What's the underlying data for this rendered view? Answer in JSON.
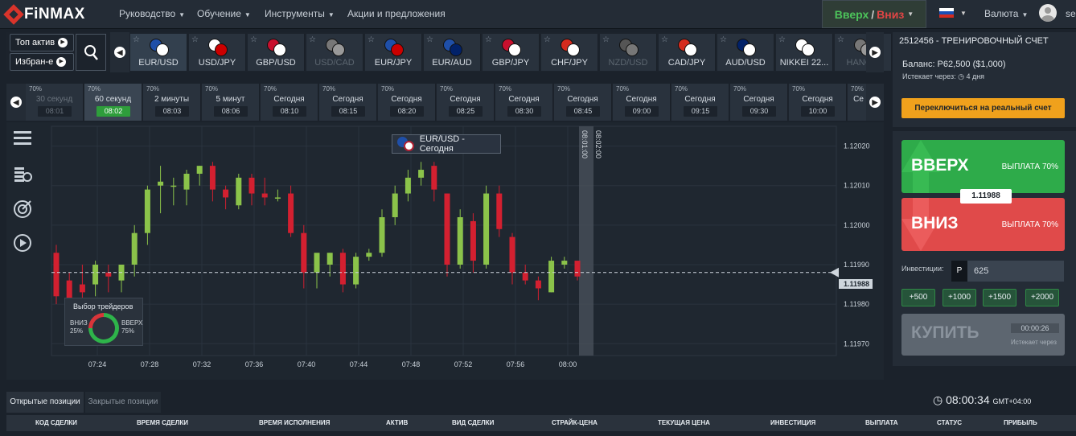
{
  "app": {
    "brand": "FiNMAX"
  },
  "nav": {
    "items": [
      "Руководство",
      "Обучение",
      "Инструменты",
      "Акции и предложения"
    ],
    "updown_up": "Вверх",
    "updown_sep": "/",
    "updown_down": "Вниз",
    "currency_label": "Валюта",
    "user_partial": "se"
  },
  "assets": {
    "top_button": "Топ актив",
    "fav_button": "Избран-е",
    "tabs": [
      {
        "label": "EUR/USD",
        "state": "active",
        "c1": "#1f4fa8",
        "c2": "#ffffff"
      },
      {
        "label": "USD/JPY",
        "state": "normal",
        "c1": "#ffffff",
        "c2": "#cc0000"
      },
      {
        "label": "GBP/USD",
        "state": "normal",
        "c1": "#c8102e",
        "c2": "#ffffff"
      },
      {
        "label": "USD/CAD",
        "state": "disabled",
        "c1": "#777777",
        "c2": "#999999"
      },
      {
        "label": "EUR/JPY",
        "state": "normal",
        "c1": "#1f4fa8",
        "c2": "#cc0000"
      },
      {
        "label": "EUR/AUD",
        "state": "normal",
        "c1": "#1f4fa8",
        "c2": "#012169"
      },
      {
        "label": "GBP/JPY",
        "state": "normal",
        "c1": "#c8102e",
        "c2": "#ffffff"
      },
      {
        "label": "CHF/JPY",
        "state": "normal",
        "c1": "#d52b1e",
        "c2": "#ffffff"
      },
      {
        "label": "NZD/USD",
        "state": "disabled",
        "c1": "#555555",
        "c2": "#777777"
      },
      {
        "label": "CAD/JPY",
        "state": "normal",
        "c1": "#d52b1e",
        "c2": "#ffffff"
      },
      {
        "label": "AUD/USD",
        "state": "normal",
        "c1": "#012169",
        "c2": "#ffffff"
      },
      {
        "label": "NIKKEI 22...",
        "state": "normal",
        "c1": "#ffffff",
        "c2": "#ffffff"
      },
      {
        "label": "HANG...",
        "state": "disabled",
        "c1": "#777777",
        "c2": "#999999"
      }
    ]
  },
  "times": {
    "tabs": [
      {
        "pct": "70%",
        "label": "30 секунд",
        "time": "08:01",
        "state": "disabled"
      },
      {
        "pct": "70%",
        "label": "60 секунд",
        "time": "08:02",
        "state": "active"
      },
      {
        "pct": "70%",
        "label": "2 минуты",
        "time": "08:03",
        "state": "normal"
      },
      {
        "pct": "70%",
        "label": "5 минут",
        "time": "08:06",
        "state": "normal"
      },
      {
        "pct": "70%",
        "label": "Сегодня",
        "time": "08:10",
        "state": "normal"
      },
      {
        "pct": "70%",
        "label": "Сегодня",
        "time": "08:15",
        "state": "normal"
      },
      {
        "pct": "70%",
        "label": "Сегодня",
        "time": "08:20",
        "state": "normal"
      },
      {
        "pct": "70%",
        "label": "Сегодня",
        "time": "08:25",
        "state": "normal"
      },
      {
        "pct": "70%",
        "label": "Сегодня",
        "time": "08:30",
        "state": "normal"
      },
      {
        "pct": "70%",
        "label": "Сегодня",
        "time": "08:45",
        "state": "normal"
      },
      {
        "pct": "70%",
        "label": "Сегодня",
        "time": "09:00",
        "state": "normal"
      },
      {
        "pct": "70%",
        "label": "Сегодня",
        "time": "09:15",
        "state": "normal"
      },
      {
        "pct": "70%",
        "label": "Сегодня",
        "time": "09:30",
        "state": "normal"
      },
      {
        "pct": "70%",
        "label": "Сегодня",
        "time": "10:00",
        "state": "normal"
      },
      {
        "pct": "70%",
        "label": "Се",
        "time": "",
        "state": "normal"
      }
    ]
  },
  "chart": {
    "tools": [
      "⊕",
      "⊖",
      "ıl",
      "1h",
      "⤴"
    ],
    "asset_label": "EUR/USD - Сегодня",
    "expiry_label_1": "08:01:00",
    "expiry_label_2": "08:02:00",
    "current_price": "1.11988",
    "traders_title": "Выбор трейдеров",
    "traders_down_label": "ВНИЗ",
    "traders_down_pct": "25%",
    "traders_up_label": "ВВЕРХ",
    "traders_up_pct": "75%"
  },
  "chart_data": {
    "type": "candlestick",
    "x_ticks": [
      "07:24",
      "07:28",
      "07:32",
      "07:36",
      "07:40",
      "07:44",
      "07:48",
      "07:52",
      "07:56",
      "08:00"
    ],
    "y_ticks": [
      "1.12020",
      "1.12010",
      "1.12000",
      "1.11990",
      "1.11980",
      "1.11970"
    ],
    "ylim": [
      1.11967,
      1.12025
    ],
    "xlim_minutes": [
      1.7,
      40
    ],
    "current_price": 1.11988,
    "candles": [
      {
        "t": 2,
        "o": 1.11993,
        "h": 1.11995,
        "l": 1.1198,
        "c": 1.11982
      },
      {
        "t": 3,
        "o": 1.11986,
        "h": 1.11988,
        "l": 1.11978,
        "c": 1.1198
      },
      {
        "t": 4,
        "o": 1.11985,
        "h": 1.1199,
        "l": 1.11978,
        "c": 1.11983
      },
      {
        "t": 5,
        "o": 1.11985,
        "h": 1.11991,
        "l": 1.11982,
        "c": 1.1199
      },
      {
        "t": 6,
        "o": 1.11988,
        "h": 1.1199,
        "l": 1.11983,
        "c": 1.11987
      },
      {
        "t": 7,
        "o": 1.11986,
        "h": 1.1199,
        "l": 1.11983,
        "c": 1.1199
      },
      {
        "t": 8,
        "o": 1.1199,
        "h": 1.12,
        "l": 1.11987,
        "c": 1.11998
      },
      {
        "t": 9,
        "o": 1.11998,
        "h": 1.1201,
        "l": 1.11995,
        "c": 1.12009
      },
      {
        "t": 10,
        "o": 1.1201,
        "h": 1.12015,
        "l": 1.12003,
        "c": 1.12011
      },
      {
        "t": 11,
        "o": 1.1201,
        "h": 1.12012,
        "l": 1.12005,
        "c": 1.1201
      },
      {
        "t": 12,
        "o": 1.12009,
        "h": 1.12014,
        "l": 1.12005,
        "c": 1.12013
      },
      {
        "t": 13,
        "o": 1.12013,
        "h": 1.12015,
        "l": 1.1201,
        "c": 1.12015
      },
      {
        "t": 14,
        "o": 1.12015,
        "h": 1.12016,
        "l": 1.12006,
        "c": 1.12009
      },
      {
        "t": 15,
        "o": 1.12009,
        "h": 1.1201,
        "l": 1.12004,
        "c": 1.12007
      },
      {
        "t": 16,
        "o": 1.12005,
        "h": 1.12013,
        "l": 1.12004,
        "c": 1.12012
      },
      {
        "t": 17,
        "o": 1.12012,
        "h": 1.12013,
        "l": 1.12005,
        "c": 1.12008
      },
      {
        "t": 18,
        "o": 1.12008,
        "h": 1.12012,
        "l": 1.12005,
        "c": 1.12007
      },
      {
        "t": 19,
        "o": 1.12007,
        "h": 1.12009,
        "l": 1.12006,
        "c": 1.12007
      },
      {
        "t": 20,
        "o": 1.12008,
        "h": 1.1201,
        "l": 1.11997,
        "c": 1.11998
      },
      {
        "t": 21,
        "o": 1.11998,
        "h": 1.12,
        "l": 1.11984,
        "c": 1.11988
      },
      {
        "t": 22,
        "o": 1.11988,
        "h": 1.11991,
        "l": 1.11984,
        "c": 1.11993
      },
      {
        "t": 23,
        "o": 1.1199,
        "h": 1.11993,
        "l": 1.11987,
        "c": 1.11993
      },
      {
        "t": 24,
        "o": 1.11993,
        "h": 1.11994,
        "l": 1.11983,
        "c": 1.11985
      },
      {
        "t": 25,
        "o": 1.11985,
        "h": 1.11993,
        "l": 1.11984,
        "c": 1.11992
      },
      {
        "t": 26,
        "o": 1.11992,
        "h": 1.11994,
        "l": 1.11991,
        "c": 1.11993
      },
      {
        "t": 27,
        "o": 1.11993,
        "h": 1.12004,
        "l": 1.11992,
        "c": 1.12002
      },
      {
        "t": 28,
        "o": 1.12002,
        "h": 1.1201,
        "l": 1.12,
        "c": 1.12008
      },
      {
        "t": 29,
        "o": 1.12008,
        "h": 1.12014,
        "l": 1.12006,
        "c": 1.12012
      },
      {
        "t": 30,
        "o": 1.12012,
        "h": 1.12016,
        "l": 1.1201,
        "c": 1.12014
      },
      {
        "t": 31,
        "o": 1.12015,
        "h": 1.12016,
        "l": 1.12006,
        "c": 1.12009
      },
      {
        "t": 32,
        "o": 1.12008,
        "h": 1.12008,
        "l": 1.11987,
        "c": 1.1199
      },
      {
        "t": 33,
        "o": 1.1199,
        "h": 1.12004,
        "l": 1.11989,
        "c": 1.12002
      },
      {
        "t": 34,
        "o": 1.12001,
        "h": 1.12003,
        "l": 1.11988,
        "c": 1.11991
      },
      {
        "t": 35,
        "o": 1.1199,
        "h": 1.1201,
        "l": 1.11989,
        "c": 1.12008
      },
      {
        "t": 36,
        "o": 1.12008,
        "h": 1.1201,
        "l": 1.11997,
        "c": 1.11999
      },
      {
        "t": 37,
        "o": 1.11997,
        "h": 1.11998,
        "l": 1.11985,
        "c": 1.11988
      },
      {
        "t": 38,
        "o": 1.11988,
        "h": 1.1199,
        "l": 1.11985,
        "c": 1.11986
      },
      {
        "t": 39,
        "o": 1.11986,
        "h": 1.11987,
        "l": 1.11981,
        "c": 1.11984
      },
      {
        "t": 40,
        "o": 1.11983,
        "h": 1.11992,
        "l": 1.11983,
        "c": 1.11991
      },
      {
        "t": 41,
        "o": 1.1199,
        "h": 1.11992,
        "l": 1.11989,
        "c": 1.11991
      },
      {
        "t": 42,
        "o": 1.11991,
        "h": 1.11991,
        "l": 1.11986,
        "c": 1.11987
      }
    ]
  },
  "account": {
    "title": "2512456 - ТРЕНИРОВОЧНЫЙ СЧЕТ",
    "balance": "Баланс: Р62,500 ($1,000)",
    "expires": "Истекает через: ◷ 4 дня",
    "switch": "Переключиться на реальный счет"
  },
  "trade": {
    "up": "ВВЕРХ",
    "up_payout": "ВЫПЛАТА 70%",
    "down": "ВНИЗ",
    "down_payout": "ВЫПЛАТА 70%",
    "strike": "1.11988",
    "investment_label": "Инвестиции:",
    "currency_symbol": "Р",
    "investment_value": "625",
    "quick": [
      "+500",
      "+1000",
      "+1500",
      "+2000"
    ],
    "buy": "КУПИТЬ",
    "timer": "00:00:26",
    "timer_label": "Истекает через"
  },
  "positions": {
    "tab_open": "Открытые позиции",
    "tab_closed": "Закрытые позиции",
    "clock": "08:00:34",
    "tz": "GMT+04:00",
    "columns": [
      "КОД СДЕЛКИ",
      "ВРЕМЯ СДЕЛКИ",
      "ВРЕМЯ ИСПОЛНЕНИЯ",
      "АКТИВ",
      "ВИД СДЕЛКИ",
      "СТРАЙК-ЦЕНА",
      "ТЕКУЩАЯ ЦЕНА",
      "ИНВЕСТИЦИЯ",
      "ВЫПЛАТА",
      "СТАТУС",
      "ПРИБЫЛЬ"
    ]
  }
}
